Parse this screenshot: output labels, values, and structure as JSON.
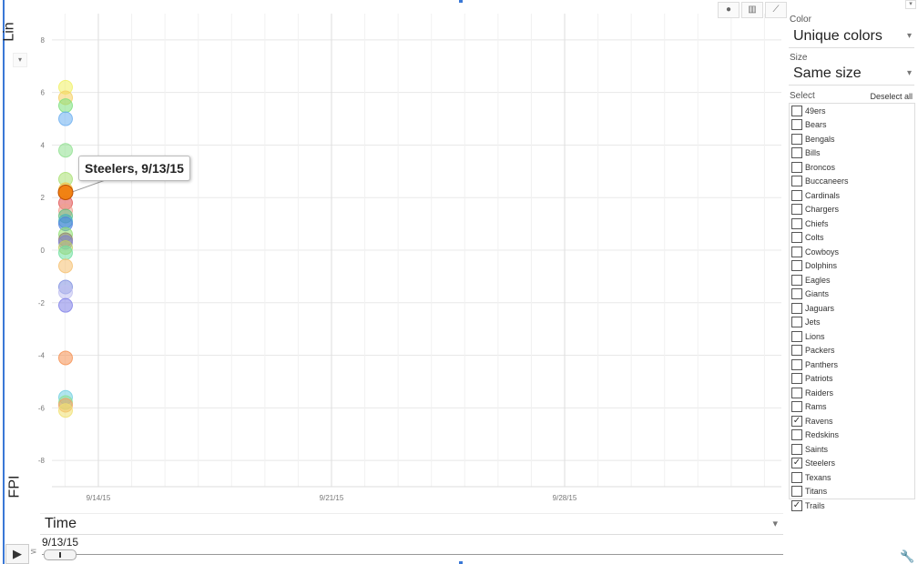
{
  "y_axis": {
    "scale_label": "Lin",
    "scale_arrow": "▾",
    "metric_label": "FPI"
  },
  "x_axis": {
    "label": "Time",
    "arrow": "▾"
  },
  "chart_data": {
    "type": "scatter",
    "xlabel": "Time",
    "ylabel": "FPI",
    "ylim": [
      -9,
      9
    ],
    "y_ticks": [
      8,
      6,
      4,
      2,
      0,
      -2,
      -4,
      -6,
      -8
    ],
    "y_tick_labels": [
      "8",
      "6",
      "4",
      "2",
      "0",
      "-2",
      "-4",
      "-6",
      "-8"
    ],
    "x_ticks": [
      "9/14/15",
      "9/21/15",
      "9/28/15"
    ],
    "grid": true,
    "x": "9/13/15",
    "points": [
      {
        "y": 6.2,
        "color": "#f0f060"
      },
      {
        "y": 5.8,
        "color": "#f5d060"
      },
      {
        "y": 5.5,
        "color": "#7be07b"
      },
      {
        "y": 5.0,
        "color": "#6aaef0"
      },
      {
        "y": 3.8,
        "color": "#8ee08e"
      },
      {
        "y": 2.7,
        "color": "#a8e070"
      },
      {
        "y": 2.3,
        "color": "#f5c040"
      },
      {
        "y": 2.2,
        "color": "#f59020"
      },
      {
        "y": 1.8,
        "color": "#e05050"
      },
      {
        "y": 1.5,
        "color": "#f0a090"
      },
      {
        "y": 1.3,
        "color": "#60c080"
      },
      {
        "y": 1.1,
        "color": "#40b0c0"
      },
      {
        "y": 1.0,
        "color": "#5080e0"
      },
      {
        "y": 0.6,
        "color": "#90e070"
      },
      {
        "y": 0.4,
        "color": "#908070"
      },
      {
        "y": 0.3,
        "color": "#8080d0"
      },
      {
        "y": 0.1,
        "color": "#c0d060"
      },
      {
        "y": -0.1,
        "color": "#70e0a0"
      },
      {
        "y": -0.6,
        "color": "#f5c070"
      },
      {
        "y": -1.4,
        "color": "#8090e0"
      },
      {
        "y": -1.6,
        "color": "#c0c0f0"
      },
      {
        "y": -2.1,
        "color": "#8080e8"
      },
      {
        "y": -4.1,
        "color": "#f59050"
      },
      {
        "y": -5.6,
        "color": "#70d0e0"
      },
      {
        "y": -5.8,
        "color": "#90e090"
      },
      {
        "y": -5.9,
        "color": "#f5a060"
      },
      {
        "y": -6.1,
        "color": "#f0e070"
      }
    ],
    "highlight": {
      "y": 2.2,
      "color": "#f08010",
      "label": "Steelers, 9/13/15"
    }
  },
  "tooltip": {
    "text": "Steelers, 9/13/15"
  },
  "chart_buttons": [
    {
      "name": "bubble-chart-icon",
      "glyph": "●"
    },
    {
      "name": "bar-chart-icon",
      "glyph": "▥"
    },
    {
      "name": "line-chart-icon",
      "glyph": "⟋"
    }
  ],
  "panel": {
    "color_label": "Color",
    "color_value": "Unique colors",
    "size_label": "Size",
    "size_value": "Same size",
    "select_label": "Select",
    "deselect_label": "Deselect all",
    "dropdown_arrow": "▾",
    "items": [
      {
        "label": "49ers",
        "checked": false
      },
      {
        "label": "Bears",
        "checked": false
      },
      {
        "label": "Bengals",
        "checked": false
      },
      {
        "label": "Bills",
        "checked": false
      },
      {
        "label": "Broncos",
        "checked": false
      },
      {
        "label": "Buccaneers",
        "checked": false
      },
      {
        "label": "Cardinals",
        "checked": false
      },
      {
        "label": "Chargers",
        "checked": false
      },
      {
        "label": "Chiefs",
        "checked": false
      },
      {
        "label": "Colts",
        "checked": false
      },
      {
        "label": "Cowboys",
        "checked": false
      },
      {
        "label": "Dolphins",
        "checked": false
      },
      {
        "label": "Eagles",
        "checked": false
      },
      {
        "label": "Giants",
        "checked": false
      },
      {
        "label": "Jaguars",
        "checked": false
      },
      {
        "label": "Jets",
        "checked": false
      },
      {
        "label": "Lions",
        "checked": false
      },
      {
        "label": "Packers",
        "checked": false
      },
      {
        "label": "Panthers",
        "checked": false
      },
      {
        "label": "Patriots",
        "checked": false
      },
      {
        "label": "Raiders",
        "checked": false
      },
      {
        "label": "Rams",
        "checked": false
      },
      {
        "label": "Ravens",
        "checked": true
      },
      {
        "label": "Redskins",
        "checked": false
      },
      {
        "label": "Saints",
        "checked": false
      },
      {
        "label": "Steelers",
        "checked": true
      },
      {
        "label": "Texans",
        "checked": false
      },
      {
        "label": "Titans",
        "checked": false
      }
    ],
    "trails_label": "Trails",
    "trails_checked": true
  },
  "playback": {
    "play_glyph": "▶",
    "speed_glyph": "⋝",
    "current_time": "9/13/15",
    "settings_glyph": "🔧"
  }
}
